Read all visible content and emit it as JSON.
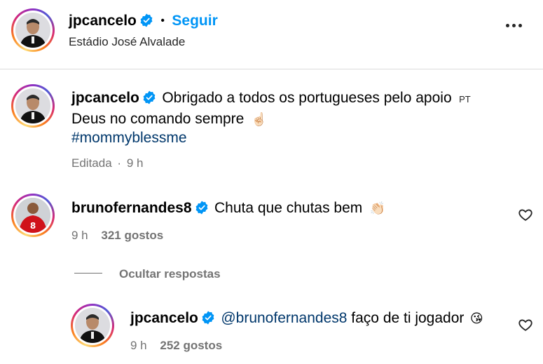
{
  "header": {
    "username": "jpcancelo",
    "separator": "•",
    "follow_label": "Seguir",
    "location": "Estádio José Alvalade"
  },
  "caption": {
    "username": "jpcancelo",
    "text_line1": "Obrigado a todos os portugueses pelo apoio",
    "lang_tag": "PT",
    "text_line2": "Deus no comando sempre",
    "emoji2": "☝🏻",
    "hashtag": "#mommyblessme",
    "edited_label": "Editada",
    "dot": "·",
    "time": "9 h"
  },
  "comment": {
    "username": "brunofernandes8",
    "text": "Chuta que chutas bem",
    "emoji": "👏🏻",
    "time": "9 h",
    "likes": "321 gostos",
    "hide_replies_label": "Ocultar respostas"
  },
  "reply": {
    "username": "jpcancelo",
    "mention": "@brunofernandes8",
    "text": " faço de ti jogador",
    "emoji": "😘",
    "time": "9 h",
    "likes": "252 gostos"
  },
  "colors": {
    "verified": "#0095f6",
    "follow": "#0095f6",
    "link": "#00376b",
    "meta": "#737373"
  },
  "icons": [
    "verified-badge-icon",
    "more-options-icon",
    "heart-icon"
  ]
}
